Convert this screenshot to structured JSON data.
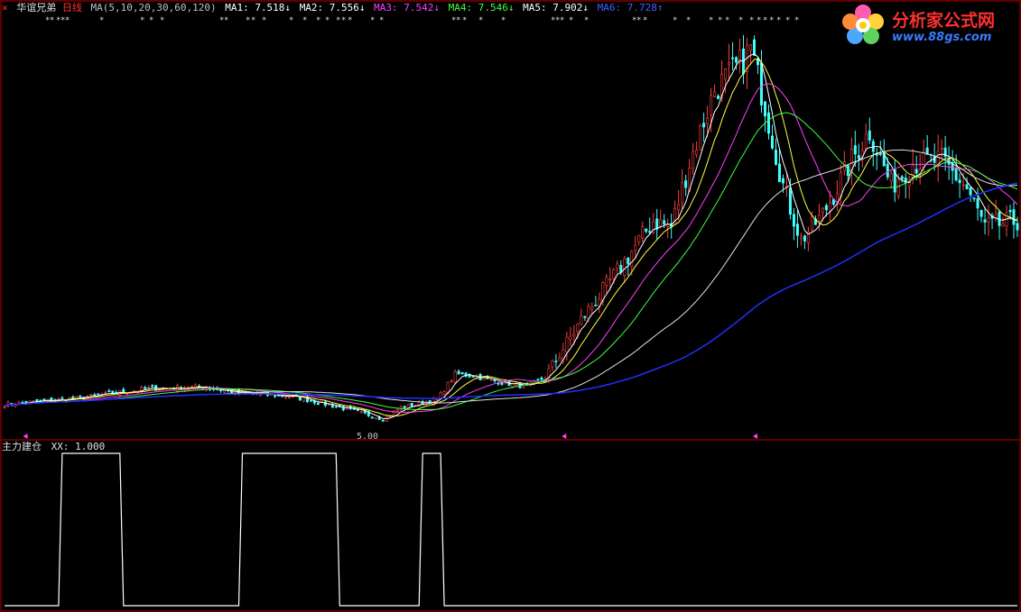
{
  "header": {
    "stock_name": "华谊兄弟",
    "period": "日线",
    "ma_params": "MA(5,10,20,30,60,120)",
    "ma": [
      {
        "text": "MA1: 7.518↓",
        "color": "#ffffff"
      },
      {
        "text": "MA2: 7.556↓",
        "color": "#ffffff"
      },
      {
        "text": "MA3: 7.542↓",
        "color": "#ff40ff"
      },
      {
        "text": "MA4: 7.546↓",
        "color": "#40ff40"
      },
      {
        "text": "MA5: 7.902↓",
        "color": "#ffffff"
      },
      {
        "text": "MA6: 7.728↑",
        "color": "#4060ff"
      }
    ],
    "period_color": "#ff3030",
    "close_icon_color": "#ff3030"
  },
  "indicator": {
    "name": "主力建仓",
    "value_text": "XX: 1.000"
  },
  "price_panel": {
    "low_label": "5.00"
  },
  "logo": {
    "title": "分析家公式网",
    "url": "www.88gs.com"
  },
  "colors": {
    "background": "#000000",
    "border": "#c00000",
    "up_candle": "#ff4040",
    "down_candle": "#40ffff",
    "ma1": "#ffffff",
    "ma2": "#ffff40",
    "ma3": "#ff40ff",
    "ma4": "#40ff40",
    "ma5": "#e0e0e0",
    "ma6": "#2030ff",
    "indicator": "#ffffff",
    "marker": "#ff40ff"
  },
  "chart_data": [
    {
      "type": "candlestick",
      "title": "华谊兄弟 日线",
      "x": {
        "count": 225,
        "labels": []
      },
      "ylim": [
        4.6,
        17.8
      ],
      "price_path": [
        [
          0,
          5.65
        ],
        [
          20,
          5.85
        ],
        [
          40,
          6.15
        ],
        [
          55,
          6.2
        ],
        [
          65,
          6.0
        ],
        [
          80,
          5.9
        ],
        [
          95,
          5.5
        ],
        [
          105,
          5.2
        ],
        [
          110,
          5.55
        ],
        [
          120,
          5.8
        ],
        [
          125,
          6.6
        ],
        [
          130,
          6.55
        ],
        [
          135,
          6.4
        ],
        [
          145,
          6.2
        ],
        [
          150,
          6.5
        ],
        [
          160,
          8.3
        ],
        [
          170,
          9.8
        ],
        [
          180,
          11.4
        ],
        [
          185,
          11.2
        ],
        [
          190,
          13.2
        ],
        [
          197,
          15.5
        ],
        [
          204,
          16.3
        ],
        [
          207,
          16.8
        ],
        [
          211,
          15.0
        ],
        [
          216,
          12.5
        ],
        [
          221,
          10.8
        ],
        [
          227,
          11.6
        ],
        [
          235,
          13.3
        ],
        [
          240,
          14.2
        ],
        [
          246,
          12.5
        ],
        [
          252,
          13.2
        ],
        [
          260,
          13.3
        ],
        [
          267,
          12.4
        ],
        [
          272,
          11.2
        ],
        [
          281,
          11.4
        ]
      ],
      "ma_lines": [
        "MA1",
        "MA2",
        "MA3",
        "MA4",
        "MA5",
        "MA6"
      ],
      "markers": [
        {
          "x_frac": 0.02
        },
        {
          "x_frac": 0.55
        },
        {
          "x_frac": 0.738
        }
      ]
    },
    {
      "type": "line",
      "title": "主力建仓",
      "series": [
        {
          "name": "XX",
          "values": [
            [
              0,
              0
            ],
            [
              15,
              0
            ],
            [
              16,
              1
            ],
            [
              32,
              1
            ],
            [
              33,
              0
            ],
            [
              65,
              0
            ],
            [
              66,
              1
            ],
            [
              92,
              1
            ],
            [
              93,
              0
            ],
            [
              115,
              0
            ],
            [
              116,
              1
            ],
            [
              121,
              1
            ],
            [
              122,
              0
            ],
            [
              281,
              0
            ]
          ]
        }
      ],
      "ylim": [
        0,
        1
      ]
    }
  ]
}
